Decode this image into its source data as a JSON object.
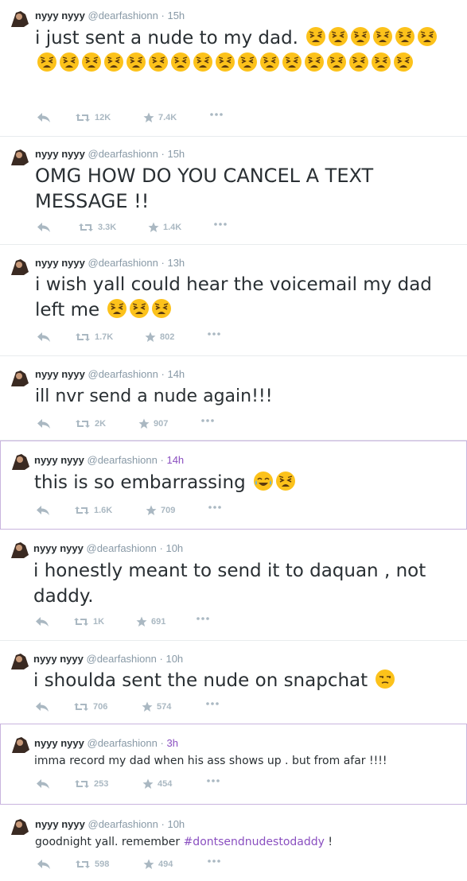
{
  "author": {
    "name": "nyyy nyyy",
    "handle": "@dearfashionn",
    "dot": "·"
  },
  "colors": {
    "text": "#292f33",
    "muted": "#8899a6",
    "action": "#aab8c2",
    "accent": "#8a4fc0"
  },
  "tweets": [
    {
      "time": "15h",
      "text": "i just sent a nude to my dad.",
      "emoji": "weary-face x23",
      "retweets": "12K",
      "favorites": "7.4K"
    },
    {
      "time": "15h",
      "text": "OMG HOW DO YOU CANCEL A TEXT MESSAGE !!",
      "retweets": "3.3K",
      "favorites": "1.4K"
    },
    {
      "time": "13h",
      "text": "i wish yall could hear the voicemail my dad left me",
      "emoji": "weary-face x3",
      "retweets": "1.7K",
      "favorites": "802"
    },
    {
      "time": "14h",
      "text": "ill nvr send a nude again!!!",
      "retweets": "2K",
      "favorites": "907"
    },
    {
      "time": "14h",
      "text": "this is so embarrassing",
      "emoji": "crying-laughing-face, weary-face",
      "retweets": "1.6K",
      "favorites": "709"
    },
    {
      "time": "10h",
      "text": "i honestly meant to send it to daquan , not daddy.",
      "retweets": "1K",
      "favorites": "691"
    },
    {
      "time": "10h",
      "text": "i shoulda sent the nude on snapchat",
      "emoji": "unamused-face",
      "retweets": "706",
      "favorites": "574"
    },
    {
      "time": "3h",
      "text": "imma record my dad when his ass shows up . but from afar !!!!",
      "retweets": "253",
      "favorites": "454"
    },
    {
      "time": "10h",
      "text": "goodnight yall. remember",
      "hashtag": "#dontsendnudestodaddy",
      "text_after": " !",
      "retweets": "598",
      "favorites": "494"
    }
  ]
}
